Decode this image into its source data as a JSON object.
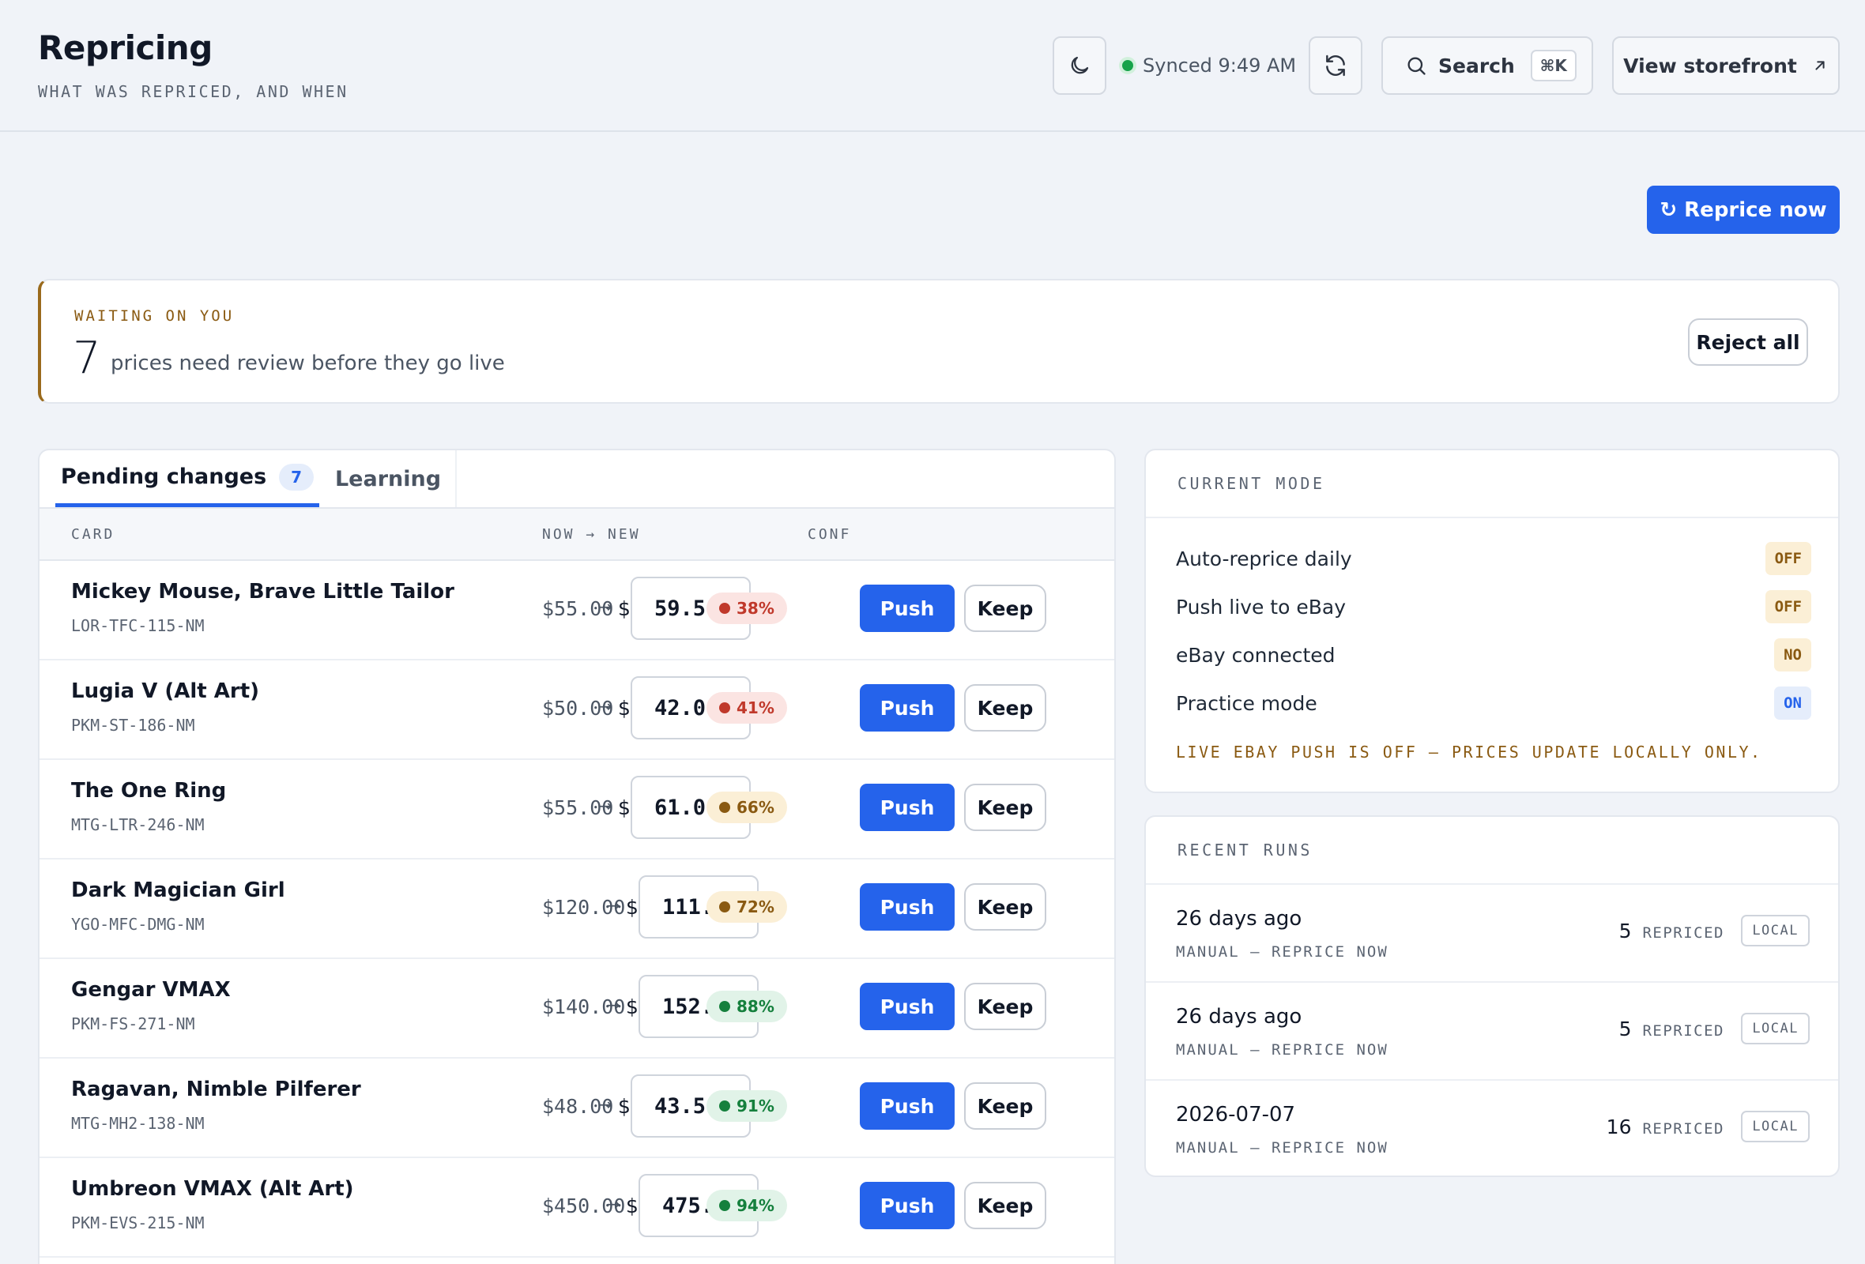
{
  "header": {
    "title": "Repricing",
    "subtitle": "WHAT WAS REPRICED, AND WHEN",
    "sync_status": "Synced 9:49 AM",
    "search_label": "Search",
    "search_shortcut": "⌘K",
    "storefront_label": "View storefront"
  },
  "actions": {
    "reprice_now": "↻ Reprice now"
  },
  "waiting": {
    "label": "WAITING ON YOU",
    "count": "7",
    "text": "prices need review before they go live",
    "reject_all": "Reject all"
  },
  "pending": {
    "tabs": [
      {
        "label": "Pending changes",
        "badge": "7"
      },
      {
        "label": "Learning"
      }
    ],
    "columns": {
      "card": "CARD",
      "now_new": "NOW → NEW",
      "conf": "CONF"
    },
    "push_label": "Push",
    "keep_label": "Keep",
    "rows": [
      {
        "name": "Mickey Mouse, Brave Little Tailor",
        "sku": "LOR-TFC-115-NM",
        "now": "$55.00",
        "arrow": "→",
        "dollar": "$",
        "new": "59.5",
        "conf": "38%",
        "level": "low"
      },
      {
        "name": "Lugia V (Alt Art)",
        "sku": "PKM-ST-186-NM",
        "now": "$50.00",
        "arrow": "→",
        "dollar": "$",
        "new": "42.0",
        "conf": "41%",
        "level": "low"
      },
      {
        "name": "The One Ring",
        "sku": "MTG-LTR-246-NM",
        "now": "$55.00",
        "arrow": "→",
        "dollar": "$",
        "new": "61.0",
        "conf": "66%",
        "level": "mid"
      },
      {
        "name": "Dark Magician Girl",
        "sku": "YGO-MFC-DMG-NM",
        "now": "$120.00",
        "arrow": "→",
        "dollar": "$",
        "new": "111.",
        "conf": "72%",
        "level": "mid"
      },
      {
        "name": "Gengar VMAX",
        "sku": "PKM-FS-271-NM",
        "now": "$140.00",
        "arrow": "→",
        "dollar": "$",
        "new": "152.",
        "conf": "88%",
        "level": "high"
      },
      {
        "name": "Ragavan, Nimble Pilferer",
        "sku": "MTG-MH2-138-NM",
        "now": "$48.00",
        "arrow": "→",
        "dollar": "$",
        "new": "43.5",
        "conf": "91%",
        "level": "high"
      },
      {
        "name": "Umbreon VMAX (Alt Art)",
        "sku": "PKM-EVS-215-NM",
        "now": "$450.00",
        "arrow": "→",
        "dollar": "$",
        "new": "475.",
        "conf": "94%",
        "level": "high"
      }
    ]
  },
  "mode": {
    "title": "CURRENT MODE",
    "rows": [
      {
        "label": "Auto-reprice daily",
        "value": "OFF"
      },
      {
        "label": "Push live to eBay",
        "value": "OFF"
      },
      {
        "label": "eBay connected",
        "value": "NO"
      },
      {
        "label": "Practice mode",
        "value": "ON"
      }
    ],
    "note": "LIVE EBAY PUSH IS OFF — PRICES UPDATE LOCALLY ONLY."
  },
  "runs": {
    "title": "RECENT RUNS",
    "items": [
      {
        "when": "26 days ago",
        "kind": "MANUAL — REPRICE NOW",
        "count": "5",
        "count_label": "REPRICED",
        "tag": "LOCAL"
      },
      {
        "when": "26 days ago",
        "kind": "MANUAL — REPRICE NOW",
        "count": "5",
        "count_label": "REPRICED",
        "tag": "LOCAL"
      },
      {
        "when": "2026-07-07",
        "kind": "MANUAL — REPRICE NOW",
        "count": "16",
        "count_label": "REPRICED",
        "tag": "LOCAL"
      }
    ]
  },
  "colors": {
    "accent": "#2563eb",
    "warning": "#8a5a12",
    "success": "#15803d",
    "danger": "#c0392b"
  },
  "icons": [
    "moon-icon",
    "refresh-icon",
    "search-icon",
    "external-link-icon"
  ]
}
